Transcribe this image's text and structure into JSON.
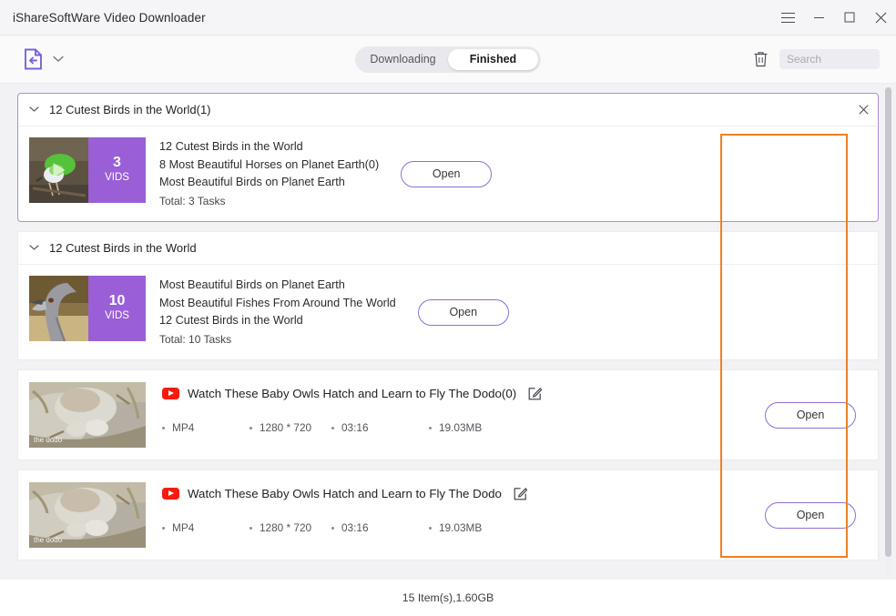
{
  "window": {
    "title": "iShareSoftWare Video Downloader",
    "menu_icon": "hamburger-icon",
    "minimize_icon": "minimize-icon",
    "maximize_icon": "maximize-icon",
    "close_icon": "close-icon"
  },
  "toolbar": {
    "doc_icon": "document-import-icon",
    "dropdown_icon": "chevron-down-icon",
    "tabs": [
      {
        "label": "Downloading",
        "active": false
      },
      {
        "label": "Finished",
        "active": true
      }
    ],
    "trash_icon": "trash-icon",
    "search": {
      "value": "",
      "placeholder": "Search"
    }
  },
  "groups": [
    {
      "header": "12 Cutest Birds in the World(1)",
      "highlighted": true,
      "close_icon": "close-icon",
      "collapse_icon": "chevron-down-icon",
      "badge_count": "3",
      "badge_unit": "VIDS",
      "lines": [
        "12 Cutest Birds in the World",
        "8 Most Beautiful Horses on Planet Earth(0)",
        "Most Beautiful Birds on Planet Earth"
      ],
      "total": "Total: 3 Tasks",
      "open_label": "Open"
    },
    {
      "header": "12 Cutest Birds in the World",
      "highlighted": false,
      "collapse_icon": "chevron-down-icon",
      "badge_count": "10",
      "badge_unit": "VIDS",
      "lines": [
        "Most Beautiful Birds on Planet Earth",
        "Most Beautiful Fishes From Around The World",
        "12 Cutest Birds in the World"
      ],
      "total": "Total: 10 Tasks",
      "open_label": "Open"
    }
  ],
  "videos": [
    {
      "source_icon": "youtube-icon",
      "title": "Watch These Baby Owls Hatch and Learn to Fly  The Dodo(0)",
      "edit_icon": "edit-icon",
      "format": "MP4",
      "resolution": "1280 * 720",
      "duration": "03:16",
      "size": "19.03MB",
      "watermark": "the dodo",
      "open_label": "Open"
    },
    {
      "source_icon": "youtube-icon",
      "title": "Watch These Baby Owls Hatch and Learn to Fly  The Dodo",
      "edit_icon": "edit-icon",
      "format": "MP4",
      "resolution": "1280 * 720",
      "duration": "03:16",
      "size": "19.03MB",
      "watermark": "the dodo",
      "open_label": "Open"
    }
  ],
  "status": {
    "summary": "15 Item(s),1.60GB"
  },
  "colors": {
    "accent_purple": "#9a5fd6",
    "button_border": "#8f6fd4",
    "annotation_orange": "#ef8023",
    "youtube_red": "#f61c0d"
  }
}
